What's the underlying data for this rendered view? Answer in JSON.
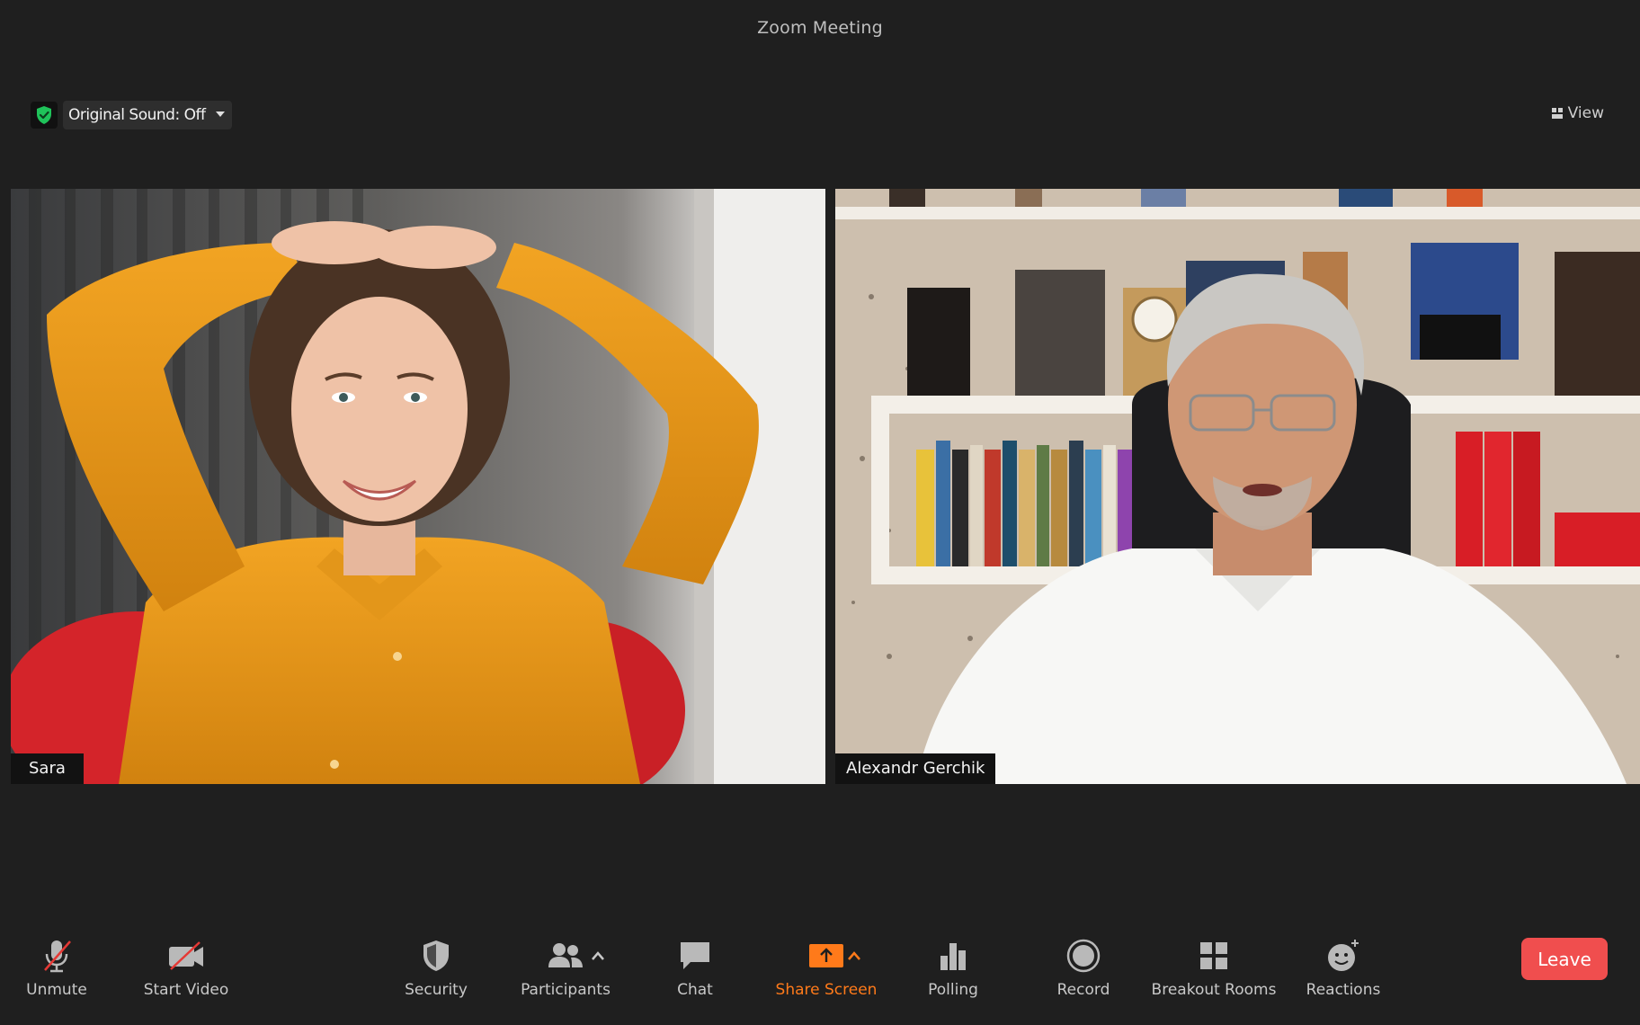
{
  "window": {
    "title": "Zoom Meeting"
  },
  "top_bar": {
    "original_sound": "Original Sound: Off",
    "view_label": "View"
  },
  "participants": [
    {
      "name": "Sara"
    },
    {
      "name": "Alexandr Gerchik"
    }
  ],
  "toolbar": {
    "unmute": "Unmute",
    "start_video": "Start Video",
    "security": "Security",
    "participants": "Participants",
    "chat": "Chat",
    "share_screen": "Share Screen",
    "polling": "Polling",
    "record": "Record",
    "breakout_rooms": "Breakout Rooms",
    "reactions": "Reactions",
    "leave": "Leave"
  },
  "colors": {
    "background": "#1f1f1f",
    "accent_orange": "#ff7a1a",
    "leave_red": "#f04e4e",
    "shield_green": "#1fc35a"
  }
}
